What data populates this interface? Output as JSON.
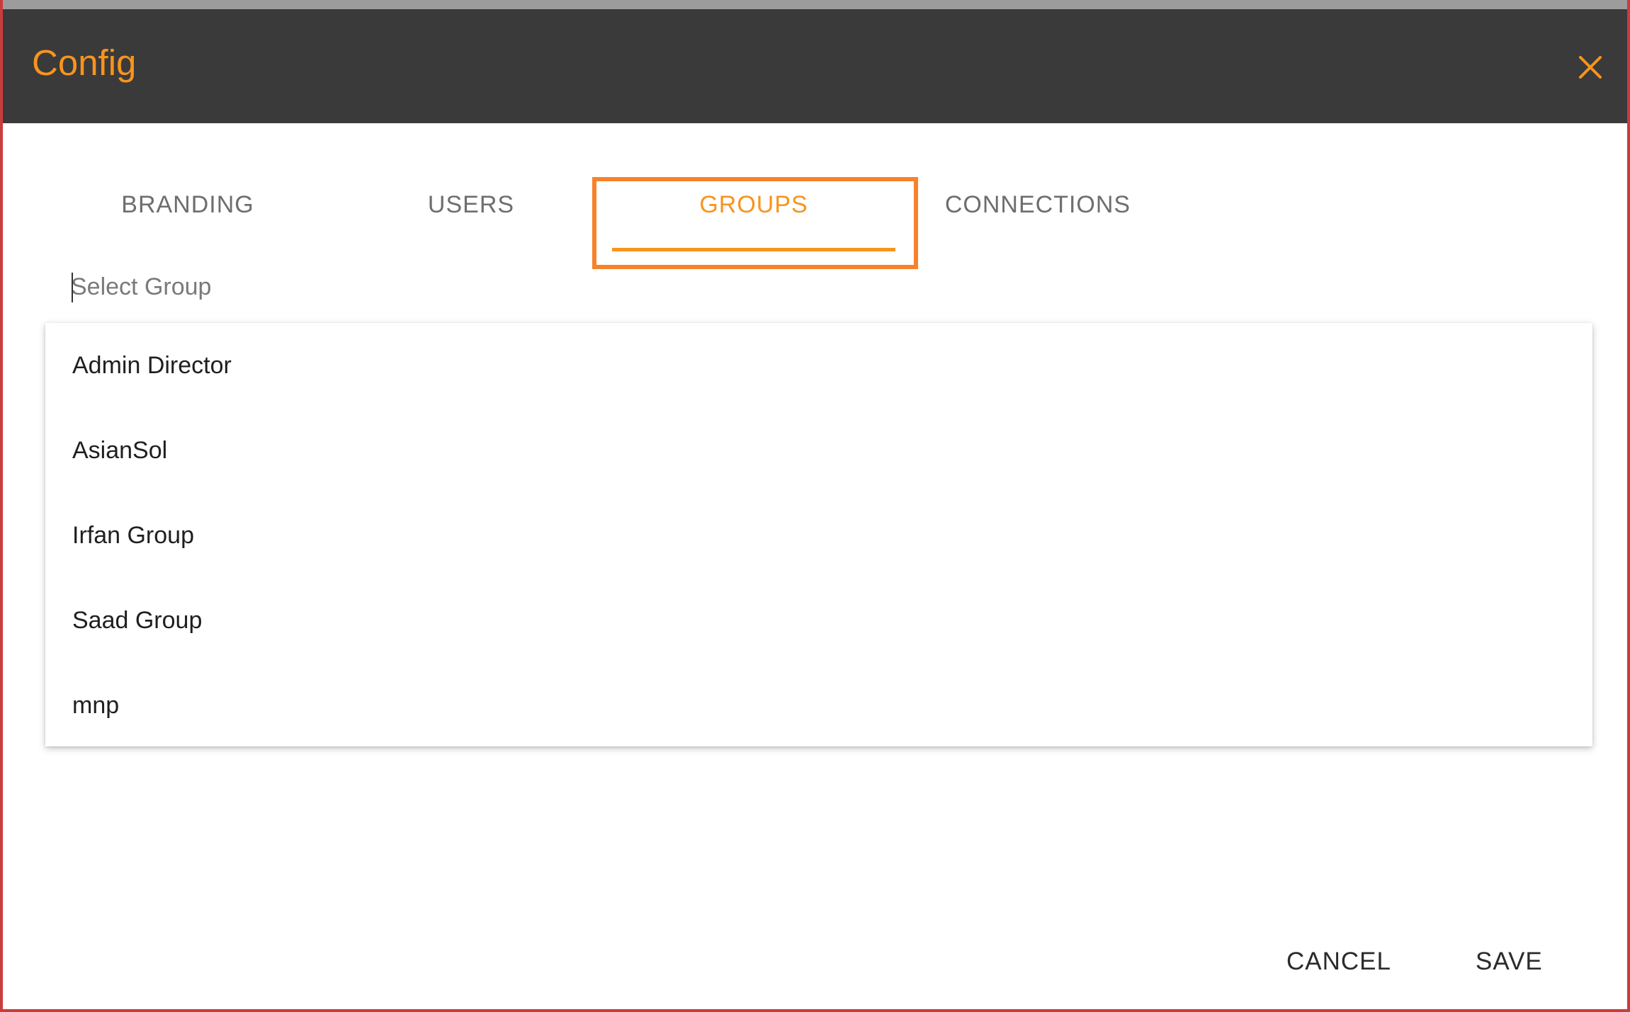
{
  "dialog": {
    "title": "Config",
    "close_icon": "close-icon",
    "accent_color": "#f7941d",
    "header_color": "#3a3a3a"
  },
  "tabs": [
    {
      "label": "BRANDING",
      "active": false
    },
    {
      "label": "USERS",
      "active": false
    },
    {
      "label": "GROUPS",
      "active": true
    },
    {
      "label": "CONNECTIONS",
      "active": false
    }
  ],
  "group_select": {
    "placeholder": "Select Group",
    "value": "",
    "options": [
      "Admin Director",
      "AsianSol",
      "Irfan Group",
      "Saad Group",
      "mnp"
    ]
  },
  "footer": {
    "cancel_label": "CANCEL",
    "save_label": "SAVE"
  }
}
